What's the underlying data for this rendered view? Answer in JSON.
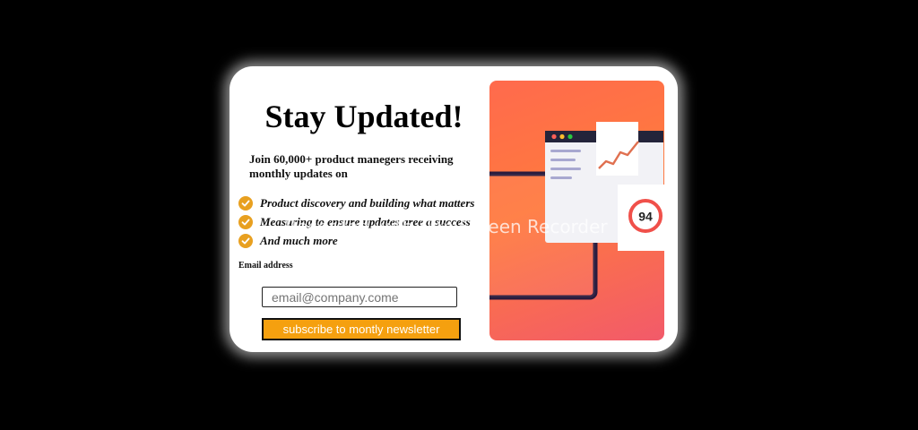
{
  "signup": {
    "title": "Stay Updated!",
    "subtitle": "Join 60,000+ product manegers receiving monthly updates on",
    "features": [
      "Product discovery and building what matters",
      "Measuring to ensure updates aree a success",
      "And much more"
    ],
    "email_label": "Email address",
    "email_placeholder": "email@company.come",
    "subscribe_label": "subscribe to montly newsletter"
  },
  "illustration": {
    "score": "94"
  },
  "watermark": "Recorded with iTop Screen Recorder",
  "colors": {
    "accent": "#f5a00f",
    "check": "#e8a020",
    "gradient_start": "#ff6a4d",
    "gradient_end": "#f25a6a"
  }
}
